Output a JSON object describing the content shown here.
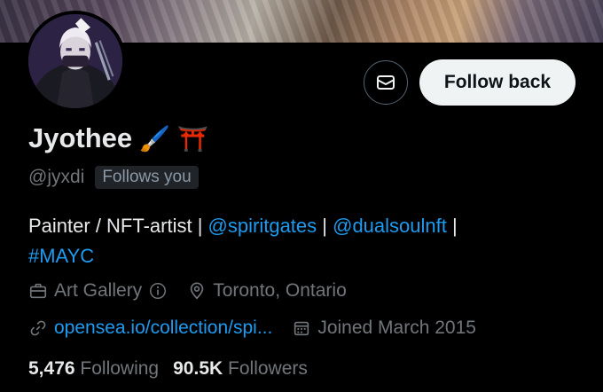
{
  "profile": {
    "name": "Jyothee",
    "name_emojis": [
      "🖌️",
      "⛩️"
    ],
    "handle": "@jyxdi",
    "follows_you_label": "Follows you"
  },
  "actions": {
    "follow_back_label": "Follow back",
    "message_icon": "envelope-icon"
  },
  "bio": {
    "text_prefix": "Painter / NFT-artist | ",
    "mention1": "@spiritgates",
    "sep1": " | ",
    "mention2": "@dualsoulnft",
    "sep2": " |",
    "hashtag": "#MAYC"
  },
  "meta": {
    "category": "Art Gallery",
    "category_icon": "briefcase-icon",
    "info_icon": "info-icon",
    "location": "Toronto, Ontario",
    "location_icon": "location-pin-icon",
    "website": "opensea.io/collection/spi...",
    "website_icon": "link-icon",
    "joined": "Joined March 2015",
    "joined_icon": "calendar-icon"
  },
  "stats": {
    "following_count": "5,476",
    "following_label": "Following",
    "followers_count": "90.5K",
    "followers_label": "Followers"
  },
  "colors": {
    "background": "#000000",
    "text_primary": "#e7e9ea",
    "text_secondary": "#71767b",
    "link": "#1d9bf0",
    "button_bg": "#eff3f4"
  }
}
